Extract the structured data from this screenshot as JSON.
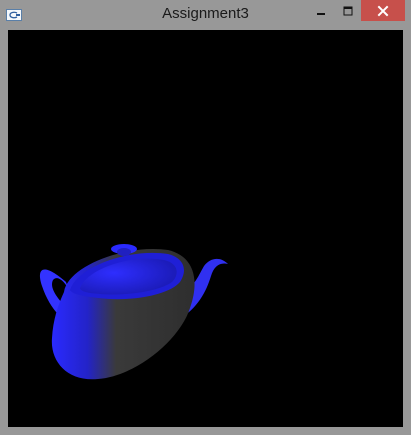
{
  "window": {
    "title": "Assignment3",
    "controls": {
      "minimize": "minimize-icon",
      "maximize": "maximize-icon",
      "close": "close-icon"
    },
    "colors": {
      "frame": "#989898",
      "close_button": "#c7504b",
      "viewport_background": "#000000",
      "teapot_lit": "#2b2bff",
      "teapot_shadow": "#3a3a3a"
    }
  },
  "viewport": {
    "scene_object": "teapot"
  }
}
